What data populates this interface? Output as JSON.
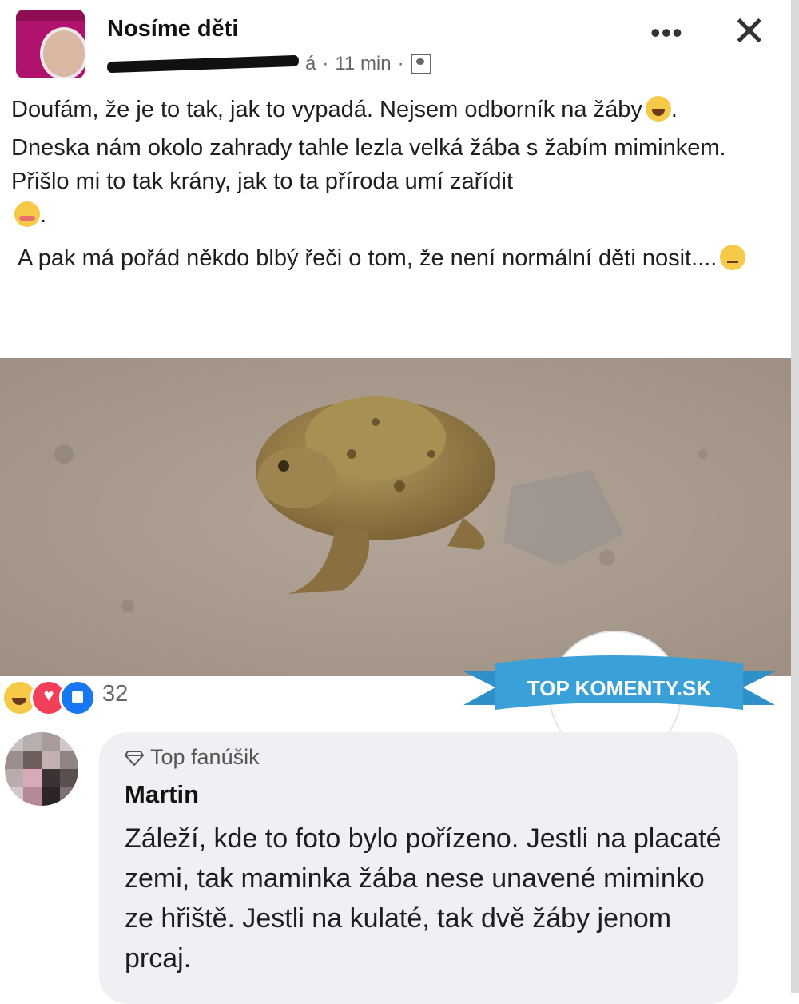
{
  "post": {
    "page_name": "Nosíme děti",
    "author_suffix": "á",
    "time": "11 min",
    "separator": "·",
    "more_label": "•••",
    "close_label": "✕",
    "text_p1": "Doufám, že je to tak, jak to vypadá. Nejsem odborník na žáby",
    "text_p1_end": ".",
    "text_p2": "Dneska nám okolo zahrady tahle lezla velká žába s žabím miminkem. Přišlo mi to tak krány, jak to ta příroda umí zařídit",
    "text_p2_end": ".",
    "text_p3": "A pak má pořád někdo blbý řeči o tom, že není normální děti nosit....",
    "icons": [
      "friends-icon",
      "laugh-emoji",
      "blush-emoji",
      "sad-emoji"
    ]
  },
  "reactions": {
    "count": "32",
    "types": [
      "haha",
      "love",
      "like"
    ]
  },
  "watermark": {
    "text": "TOP KOMENTY.SK"
  },
  "comment": {
    "badge": "Top fanúšik",
    "author": "Martin",
    "text": "Záleží, kde to foto bylo pořízeno. Jestli na placaté zemi, tak maminka žába nese unavené miminko ze hřiště. Jestli na kulaté, tak dvě žáby jenom prcaj."
  },
  "colors": {
    "text": "#1c1e21",
    "meta": "#65676b",
    "bubble": "#eef0f3",
    "like": "#1877f2",
    "love": "#f33e58",
    "haha": "#f7c948",
    "banner": "#3aa0d8"
  }
}
